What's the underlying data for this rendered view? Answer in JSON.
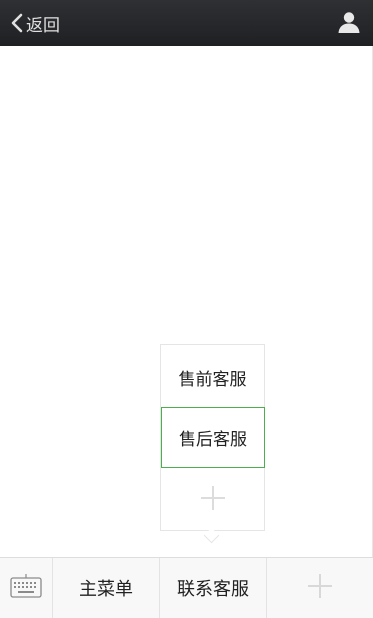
{
  "header": {
    "back_label": "返回",
    "icons": {
      "back": "chevron-left-icon",
      "user": "user-icon"
    }
  },
  "popup": {
    "items": [
      {
        "label": "售前客服"
      },
      {
        "label": "售后客服",
        "selected": true
      }
    ],
    "add_icon": "plus-icon"
  },
  "bottom_menu": {
    "keyboard_icon": "keyboard-icon",
    "items": [
      {
        "label": "主菜单"
      },
      {
        "label": "联系客服"
      }
    ],
    "add_icon": "plus-icon"
  },
  "colors": {
    "header_bg": "#2a2b2e",
    "selected_border": "#4cae4c",
    "bar_bg": "#f8f8f8"
  }
}
